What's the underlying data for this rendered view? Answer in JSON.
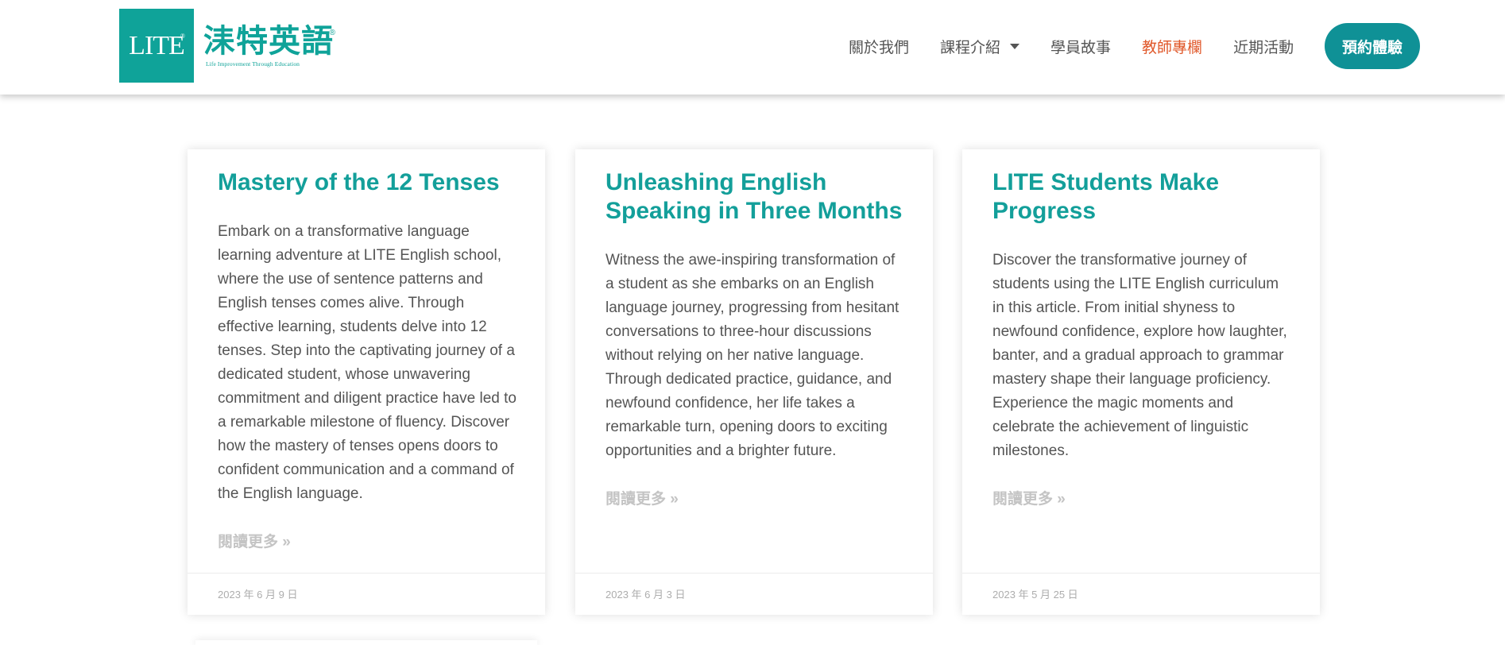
{
  "header": {
    "logo": {
      "mark": "LITE",
      "mark_superscript": "®",
      "chinese_name": "洡特英語",
      "registered": "®",
      "tagline": "Life Improvement Through Education"
    },
    "nav": [
      {
        "label": "關於我們"
      },
      {
        "label": "課程介紹"
      },
      {
        "label": "學員故事"
      },
      {
        "label": "教師專欄"
      },
      {
        "label": "近期活動"
      }
    ],
    "cta_label": "預約體驗"
  },
  "colors": {
    "brand_teal": "#0fa399",
    "title_teal": "#139f9a",
    "cta_teal": "#0f9196",
    "active_nav": "#e0582a"
  },
  "icons": [
    "chevron-down-icon"
  ],
  "posts": [
    {
      "title": "Mastery of the 12 Tenses",
      "excerpt": "Embark on a transformative language learning adventure at LITE English school, where the use of sentence patterns and English tenses comes alive. Through effective learning, students delve into 12 tenses. Step into the captivating journey of a dedicated student, whose unwavering commitment and diligent practice have led to a remarkable milestone of fluency. Discover how the mastery of tenses opens doors to confident communication and a command of the English language.",
      "read_more": "閱讀更多 »",
      "date": "2023 年 6 月 9 日"
    },
    {
      "title": "Unleashing English Speaking in Three Months",
      "excerpt": "Witness the awe-inspiring transformation of a student as she embarks on an English language journey, progressing from hesitant conversations to three-hour discussions without relying on her native language. Through dedicated practice, guidance, and newfound confidence, her life takes a remarkable turn, opening doors to exciting opportunities and a brighter future.",
      "read_more": "閱讀更多 »",
      "date": "2023 年 6 月 3 日"
    },
    {
      "title": "LITE Students Make Progress",
      "excerpt": "Discover the transformative journey of students using the LITE English curriculum in this article. From initial shyness to newfound confidence, explore how laughter, banter, and a gradual approach to grammar mastery shape their language proficiency. Experience the magic moments and celebrate the achievement of linguistic milestones.",
      "read_more": "閱讀更多 »",
      "date": "2023 年 5 月 25 日"
    }
  ]
}
